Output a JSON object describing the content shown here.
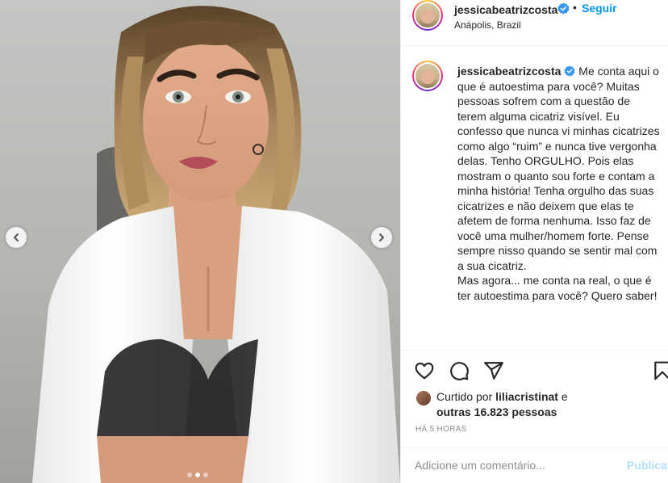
{
  "post": {
    "username": "jessicabeatrizcosta",
    "verified_icon": "verified-badge-icon",
    "separator": "•",
    "follow_label": "Seguir",
    "location": "Anápolis, Brazil"
  },
  "caption": {
    "username": "jessicabeatrizcosta",
    "text": "Me conta aqui o que é autoestima para você? Muitas pessoas sofrem com a questão de terem alguma cicatriz visível. Eu confesso que nunca vi minhas cicatrizes como algo “ruim” e nunca tive vergonha delas. Tenho ORGULHO. Pois elas mostram o quanto sou forte e contam a minha história! Tenha orgulho das suas cicatrizes e não deixem que elas te afetem de forma nenhuma. Isso faz de você uma mulher/homem forte. Pense sempre nisso quando se sentir mal com a sua cicatriz.\nMas agora... me conta na real, o que é ter autoestima para você? Quero saber!"
  },
  "carousel": {
    "prev_icon": "chevron-left-icon",
    "next_icon": "chevron-right-icon",
    "slide_count": 3,
    "active_index": 2
  },
  "actions": {
    "like_icon": "heart-icon",
    "comment_icon": "comment-icon",
    "share_icon": "paper-plane-icon",
    "save_icon": "bookmark-icon"
  },
  "likes": {
    "prefix": "Curtido por ",
    "liker": "liliacristinat",
    "connector": " e",
    "others": "outras 16.823 pessoas"
  },
  "timestamp": "HÁ 5 HORAS",
  "comment": {
    "placeholder": "Adicione um comentário...",
    "publish_label": "Publicar"
  },
  "colors": {
    "link_blue": "#0095f6",
    "publish_disabled": "#b2dffc",
    "verified_blue": "#3897f0",
    "muted_text": "#8e8e8e"
  }
}
